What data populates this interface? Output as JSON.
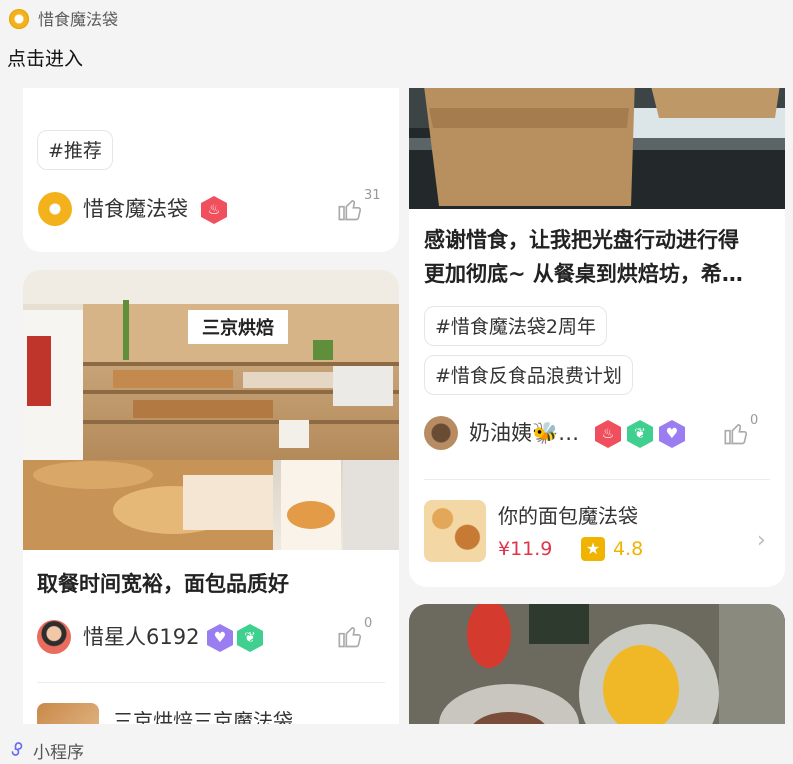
{
  "header": {
    "app_name": "惜食魔法袋",
    "enter_label": "点击进入"
  },
  "posts": [
    {
      "tag": "#推荐",
      "user": "惜食魔法袋",
      "likes": "31"
    },
    {
      "title": "取餐时间宽裕，面包品质好",
      "user": "惜星人6192",
      "likes": "0",
      "shop_name": "三京烘焙三京魔法袋",
      "store_sign": "三京烘焙"
    },
    {
      "title_line1": "感谢惜食，让我把光盘行动进行得",
      "title_line2": "更加彻底~ 从餐桌到烘焙坊，希…",
      "tags": [
        "#惜食魔法袋2周年",
        "#惜食反食品浪费计划"
      ],
      "user": "奶油姨🐝…",
      "likes": "0",
      "shop_name": "你的面包魔法袋",
      "price": "¥11.9",
      "rating": "4.8"
    }
  ],
  "footer": {
    "mini_program_label": "小程序"
  },
  "colors": {
    "price": "#e0344a",
    "rating": "#f0b400",
    "badge_red": "#f0505e",
    "badge_green": "#3fcf8e",
    "badge_purple": "#9b7df2"
  }
}
